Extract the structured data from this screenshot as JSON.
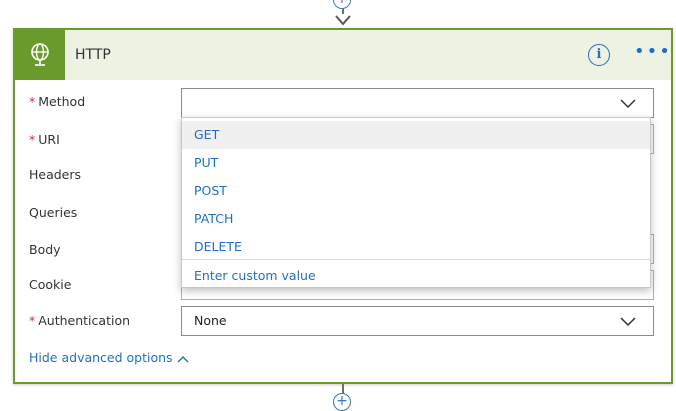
{
  "card": {
    "title": "HTTP",
    "icon": "globe-icon",
    "colors": {
      "accent": "#6b9a2c",
      "header_bg": "#eef2e3",
      "link": "#1f6fc5",
      "required": "#c4314b"
    }
  },
  "form": {
    "method_label": "Method",
    "method_value": "",
    "uri_label": "URI",
    "headers_label": "Headers",
    "queries_label": "Queries",
    "body_label": "Body",
    "cookie_label": "Cookie",
    "authentication_label": "Authentication",
    "authentication_value": "None",
    "required_marker": "*",
    "advanced_link": "Hide advanced options"
  },
  "dropdown": {
    "options": [
      "GET",
      "PUT",
      "POST",
      "PATCH",
      "DELETE"
    ],
    "custom_value": "Enter custom value",
    "highlighted": "GET"
  }
}
